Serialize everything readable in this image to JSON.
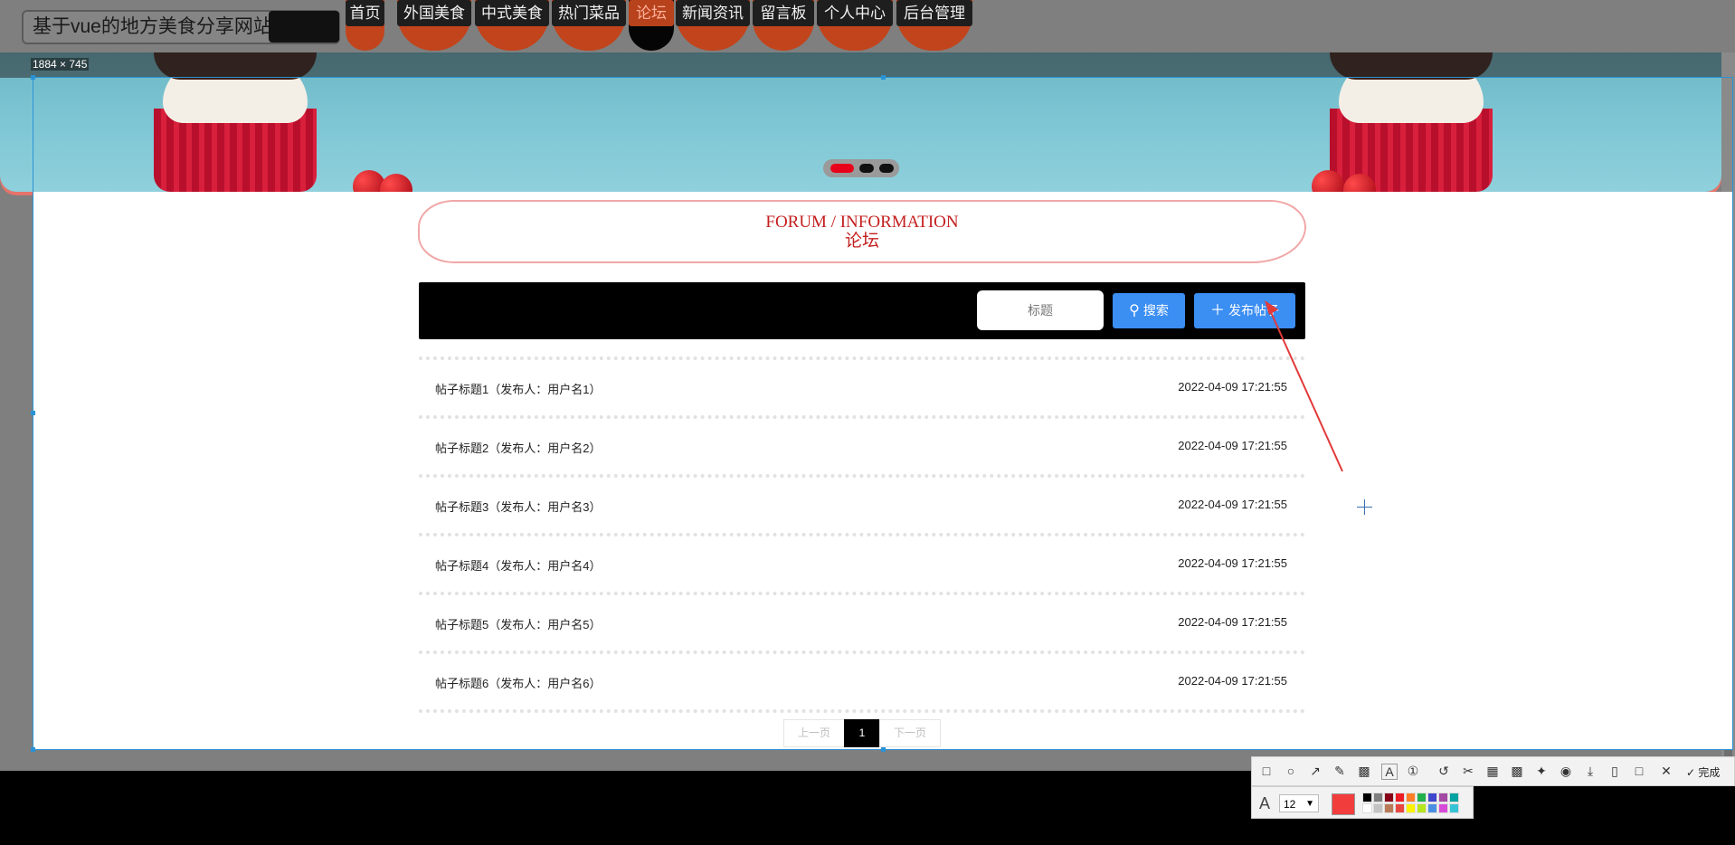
{
  "site": {
    "title": "基于vue的地方美食分享网站"
  },
  "nav": {
    "items": [
      {
        "label": "首页"
      },
      {
        "label": "外国美食"
      },
      {
        "label": "中式美食"
      },
      {
        "label": "热门菜品"
      },
      {
        "label": "论坛",
        "active": true
      },
      {
        "label": "新闻资讯"
      },
      {
        "label": "留言板"
      },
      {
        "label": "个人中心"
      },
      {
        "label": "后台管理"
      }
    ]
  },
  "capture": {
    "size_label": "1884 × 745"
  },
  "forum": {
    "title_en": "FORUM / INFORMATION",
    "title_cn": "论坛",
    "search_placeholder": "标题",
    "search_button": "搜索",
    "post_button": "发布帖子",
    "posts": [
      {
        "title": "帖子标题1（发布人：用户名1）",
        "time": "2022-04-09 17:21:55"
      },
      {
        "title": "帖子标题2（发布人：用户名2）",
        "time": "2022-04-09 17:21:55"
      },
      {
        "title": "帖子标题3（发布人：用户名3）",
        "time": "2022-04-09 17:21:55"
      },
      {
        "title": "帖子标题4（发布人：用户名4）",
        "time": "2022-04-09 17:21:55"
      },
      {
        "title": "帖子标题5（发布人：用户名5）",
        "time": "2022-04-09 17:21:55"
      },
      {
        "title": "帖子标题6（发布人：用户名6）",
        "time": "2022-04-09 17:21:55"
      }
    ],
    "pager": {
      "prev": "上一页",
      "current": "1",
      "next": "下一页"
    }
  },
  "annotation_toolbar": {
    "done_label": "完成",
    "font_size": "12",
    "current_color": "#f23d3d",
    "palette": [
      "#000000",
      "#7f7f7f",
      "#880015",
      "#ed1c24",
      "#ff7f27",
      "#22b14c",
      "#3f48cc",
      "#a349a4",
      "#00a2a2",
      "#ffffff",
      "#c3c3c3",
      "#b97a57",
      "#e8473f",
      "#fff200",
      "#b5e61d",
      "#4a90e2",
      "#d84bd8",
      "#35c4d6"
    ]
  }
}
